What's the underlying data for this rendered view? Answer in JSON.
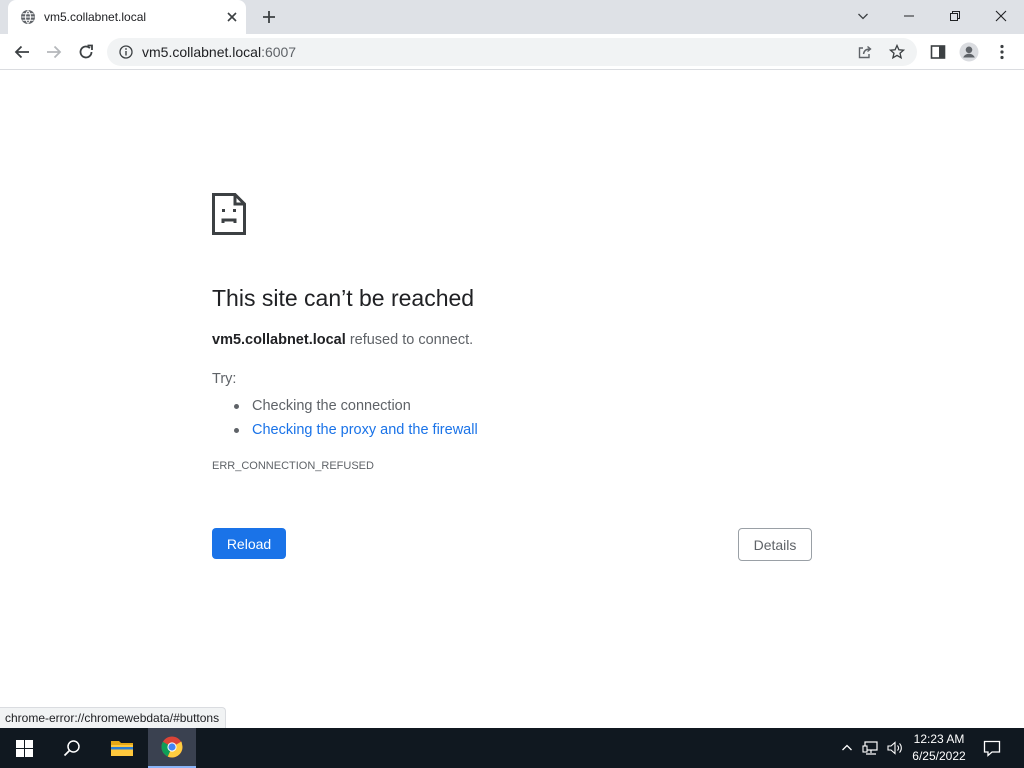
{
  "browser": {
    "tab": {
      "title": "vm5.collabnet.local",
      "favicon": "globe-icon"
    },
    "window_controls": [
      "chevron-down-icon",
      "minimize-icon",
      "restore-icon",
      "close-icon"
    ],
    "toolbar": {
      "url_host": "vm5.collabnet.local",
      "url_port": ":6007",
      "icons": [
        "back-arrow-icon",
        "forward-arrow-icon",
        "reload-icon",
        "info-icon",
        "share-icon",
        "star-icon",
        "side-panel-icon",
        "profile-icon",
        "menu-icon"
      ]
    }
  },
  "error_page": {
    "title": "This site can’t be reached",
    "host": "vm5.collabnet.local",
    "message": "refused to connect.",
    "try_label": "Try:",
    "suggestions": [
      {
        "text": "Checking the connection",
        "link": false
      },
      {
        "text": "Checking the proxy and the firewall",
        "link": true
      }
    ],
    "error_code": "ERR_CONNECTION_REFUSED",
    "reload_label": "Reload",
    "details_label": "Details"
  },
  "status_bar": {
    "text": "chrome-error://chromewebdata/#buttons"
  },
  "taskbar": {
    "time": "12:23 AM",
    "date": "6/25/2022",
    "apps": [
      "windows-start-icon",
      "search-icon",
      "file-explorer-icon",
      "chrome-icon"
    ],
    "tray": [
      "chevron-up-icon",
      "network-icon",
      "volume-icon",
      "notification-icon"
    ]
  },
  "colors": {
    "accent": "#1a73e8",
    "tabstrip": "#dee1e6",
    "taskbar": "#101820"
  }
}
